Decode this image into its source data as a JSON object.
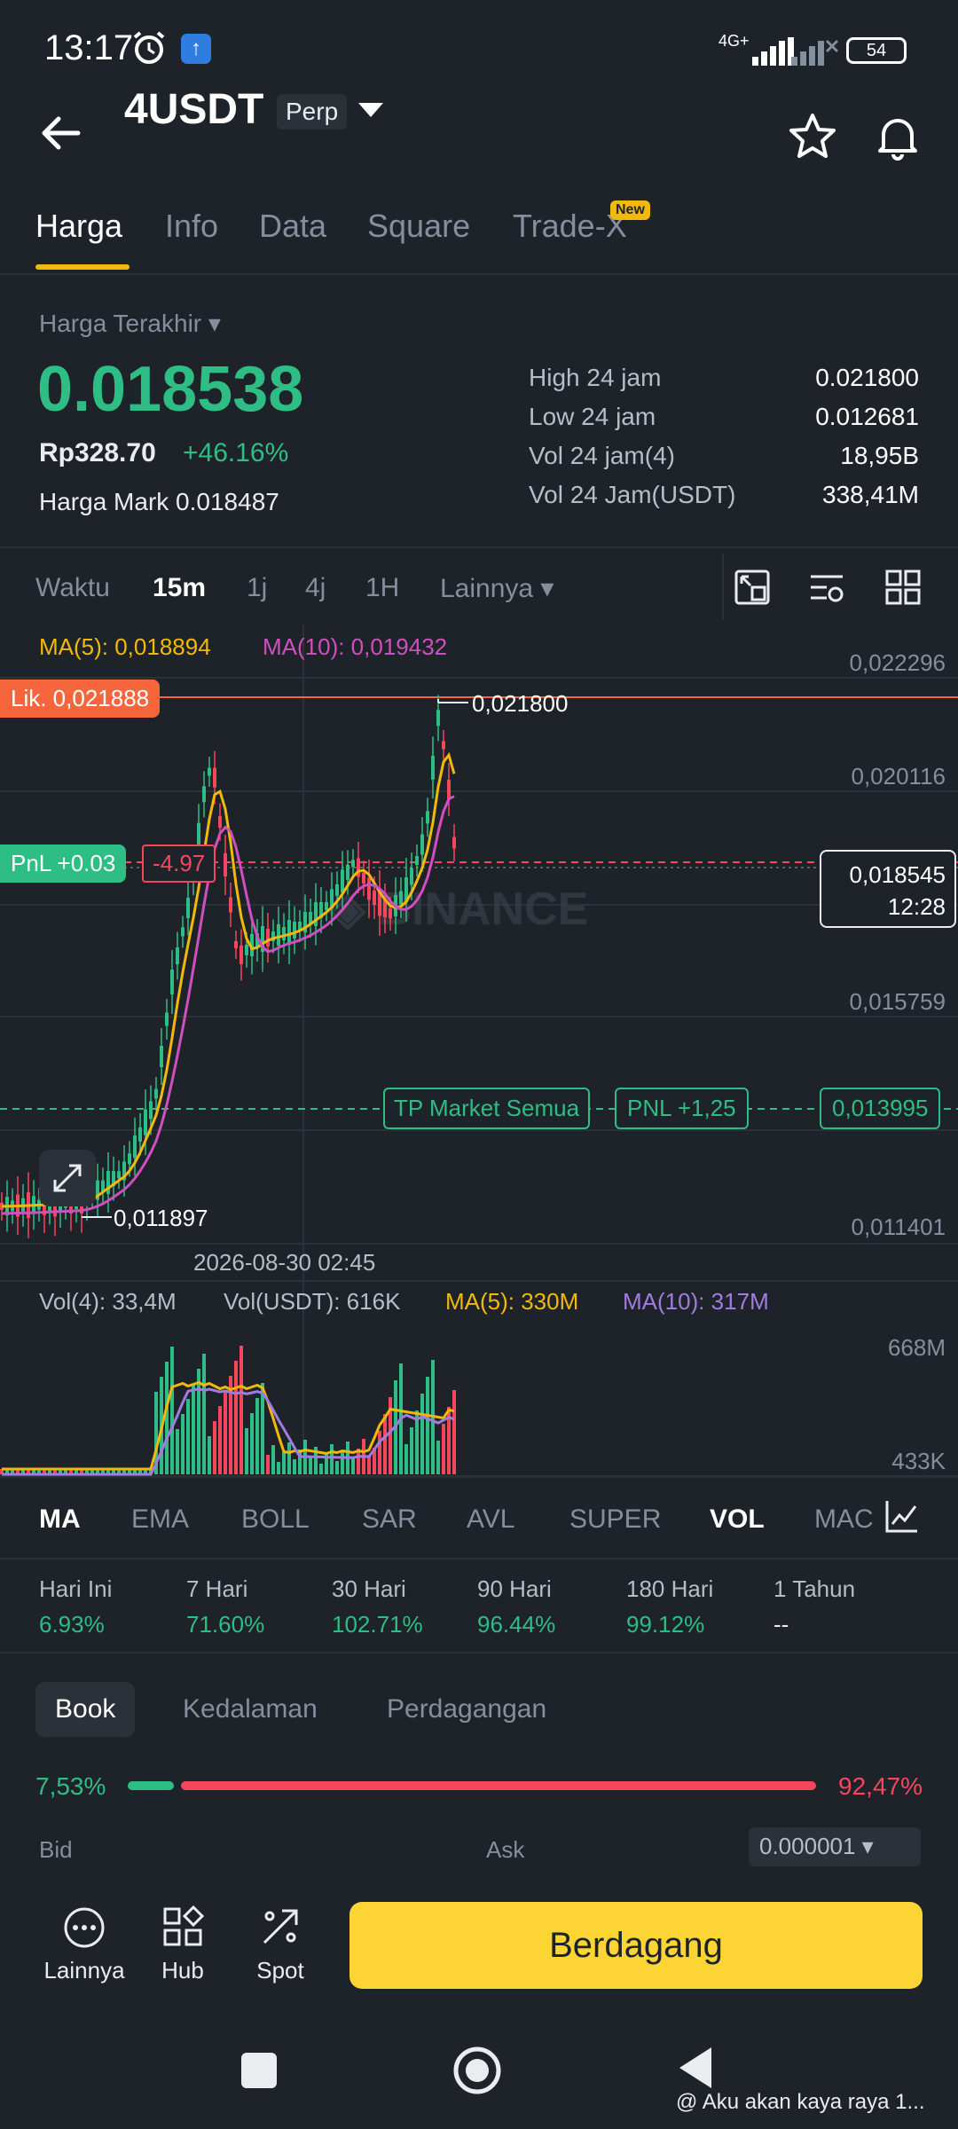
{
  "status_bar": {
    "time": "13:17",
    "network": "4G+",
    "battery": "54"
  },
  "header": {
    "pair": "4USDT",
    "badge": "Perp"
  },
  "tabs": [
    {
      "label": "Harga"
    },
    {
      "label": "Info"
    },
    {
      "label": "Data"
    },
    {
      "label": "Square"
    },
    {
      "label": "Trade-X"
    }
  ],
  "tab_new_badge": "New",
  "price": {
    "last_label": "Harga Terakhir",
    "last": "0.018538",
    "rp": "Rp328.70",
    "change": "+46.16%",
    "mark_label": "Harga Mark",
    "mark_value": "0.018487"
  },
  "stats": [
    {
      "label": "High 24 jam",
      "value": "0.021800"
    },
    {
      "label": "Low 24 jam",
      "value": "0.012681"
    },
    {
      "label": "Vol 24 jam(4)",
      "value": "18,95B"
    },
    {
      "label": "Vol 24 Jam(USDT)",
      "value": "338,41M"
    }
  ],
  "timeframes": [
    {
      "label": "Waktu"
    },
    {
      "label": "15m"
    },
    {
      "label": "1j"
    },
    {
      "label": "4j"
    },
    {
      "label": "1H"
    },
    {
      "label": "Lainnya"
    }
  ],
  "chart": {
    "ma5": "MA(5): 0,018894",
    "ma10": "MA(10): 0,019432",
    "axis": [
      "0,022296",
      "0,020116",
      "0,015759",
      "0,011401"
    ],
    "liq": "Lik. 0,021888",
    "high_label": "0,021800",
    "low_label": "0,011897",
    "pnl": "PnL +0.03",
    "pnl_value": "-4.97",
    "current_price": "0,018545",
    "countdown": "12:28",
    "tp_label": "TP Market Semua",
    "tp_pnl": "PNL +1,25",
    "tp_price": "0,013995",
    "date": "2026-08-30 02:45",
    "colors": {
      "up": "#2ebd85",
      "down": "#f6465d",
      "ma5": "#f0b90b",
      "ma10": "#d04fbf"
    }
  },
  "volume": {
    "vol4": "Vol(4): 33,4M",
    "volusdt": "Vol(USDT): 616K",
    "ma5": "MA(5): 330M",
    "ma10": "MA(10): 317M",
    "axis_top": "668M",
    "axis_bottom": "433K"
  },
  "indicators": [
    {
      "label": "MA"
    },
    {
      "label": "EMA"
    },
    {
      "label": "BOLL"
    },
    {
      "label": "SAR"
    },
    {
      "label": "AVL"
    },
    {
      "label": "SUPER"
    },
    {
      "label": "VOL"
    },
    {
      "label": "MAC"
    }
  ],
  "performance": [
    {
      "label": "Hari Ini",
      "value": "6.93%"
    },
    {
      "label": "7 Hari",
      "value": "71.60%"
    },
    {
      "label": "30 Hari",
      "value": "102.71%"
    },
    {
      "label": "90 Hari",
      "value": "96.44%"
    },
    {
      "label": "180 Hari",
      "value": "99.12%"
    },
    {
      "label": "1 Tahun",
      "value": "--"
    }
  ],
  "book": {
    "tabs": [
      {
        "label": "Book"
      },
      {
        "label": "Kedalaman"
      },
      {
        "label": "Perdagangan"
      }
    ],
    "bid_pct": "7,53%",
    "ask_pct": "92,47%",
    "bid": "Bid",
    "ask": "Ask",
    "tick": "0.000001"
  },
  "bottom": {
    "more": "Lainnya",
    "hub": "Hub",
    "spot": "Spot",
    "trade": "Berdagang"
  },
  "toast": "@ Aku akan kaya raya 1..."
}
